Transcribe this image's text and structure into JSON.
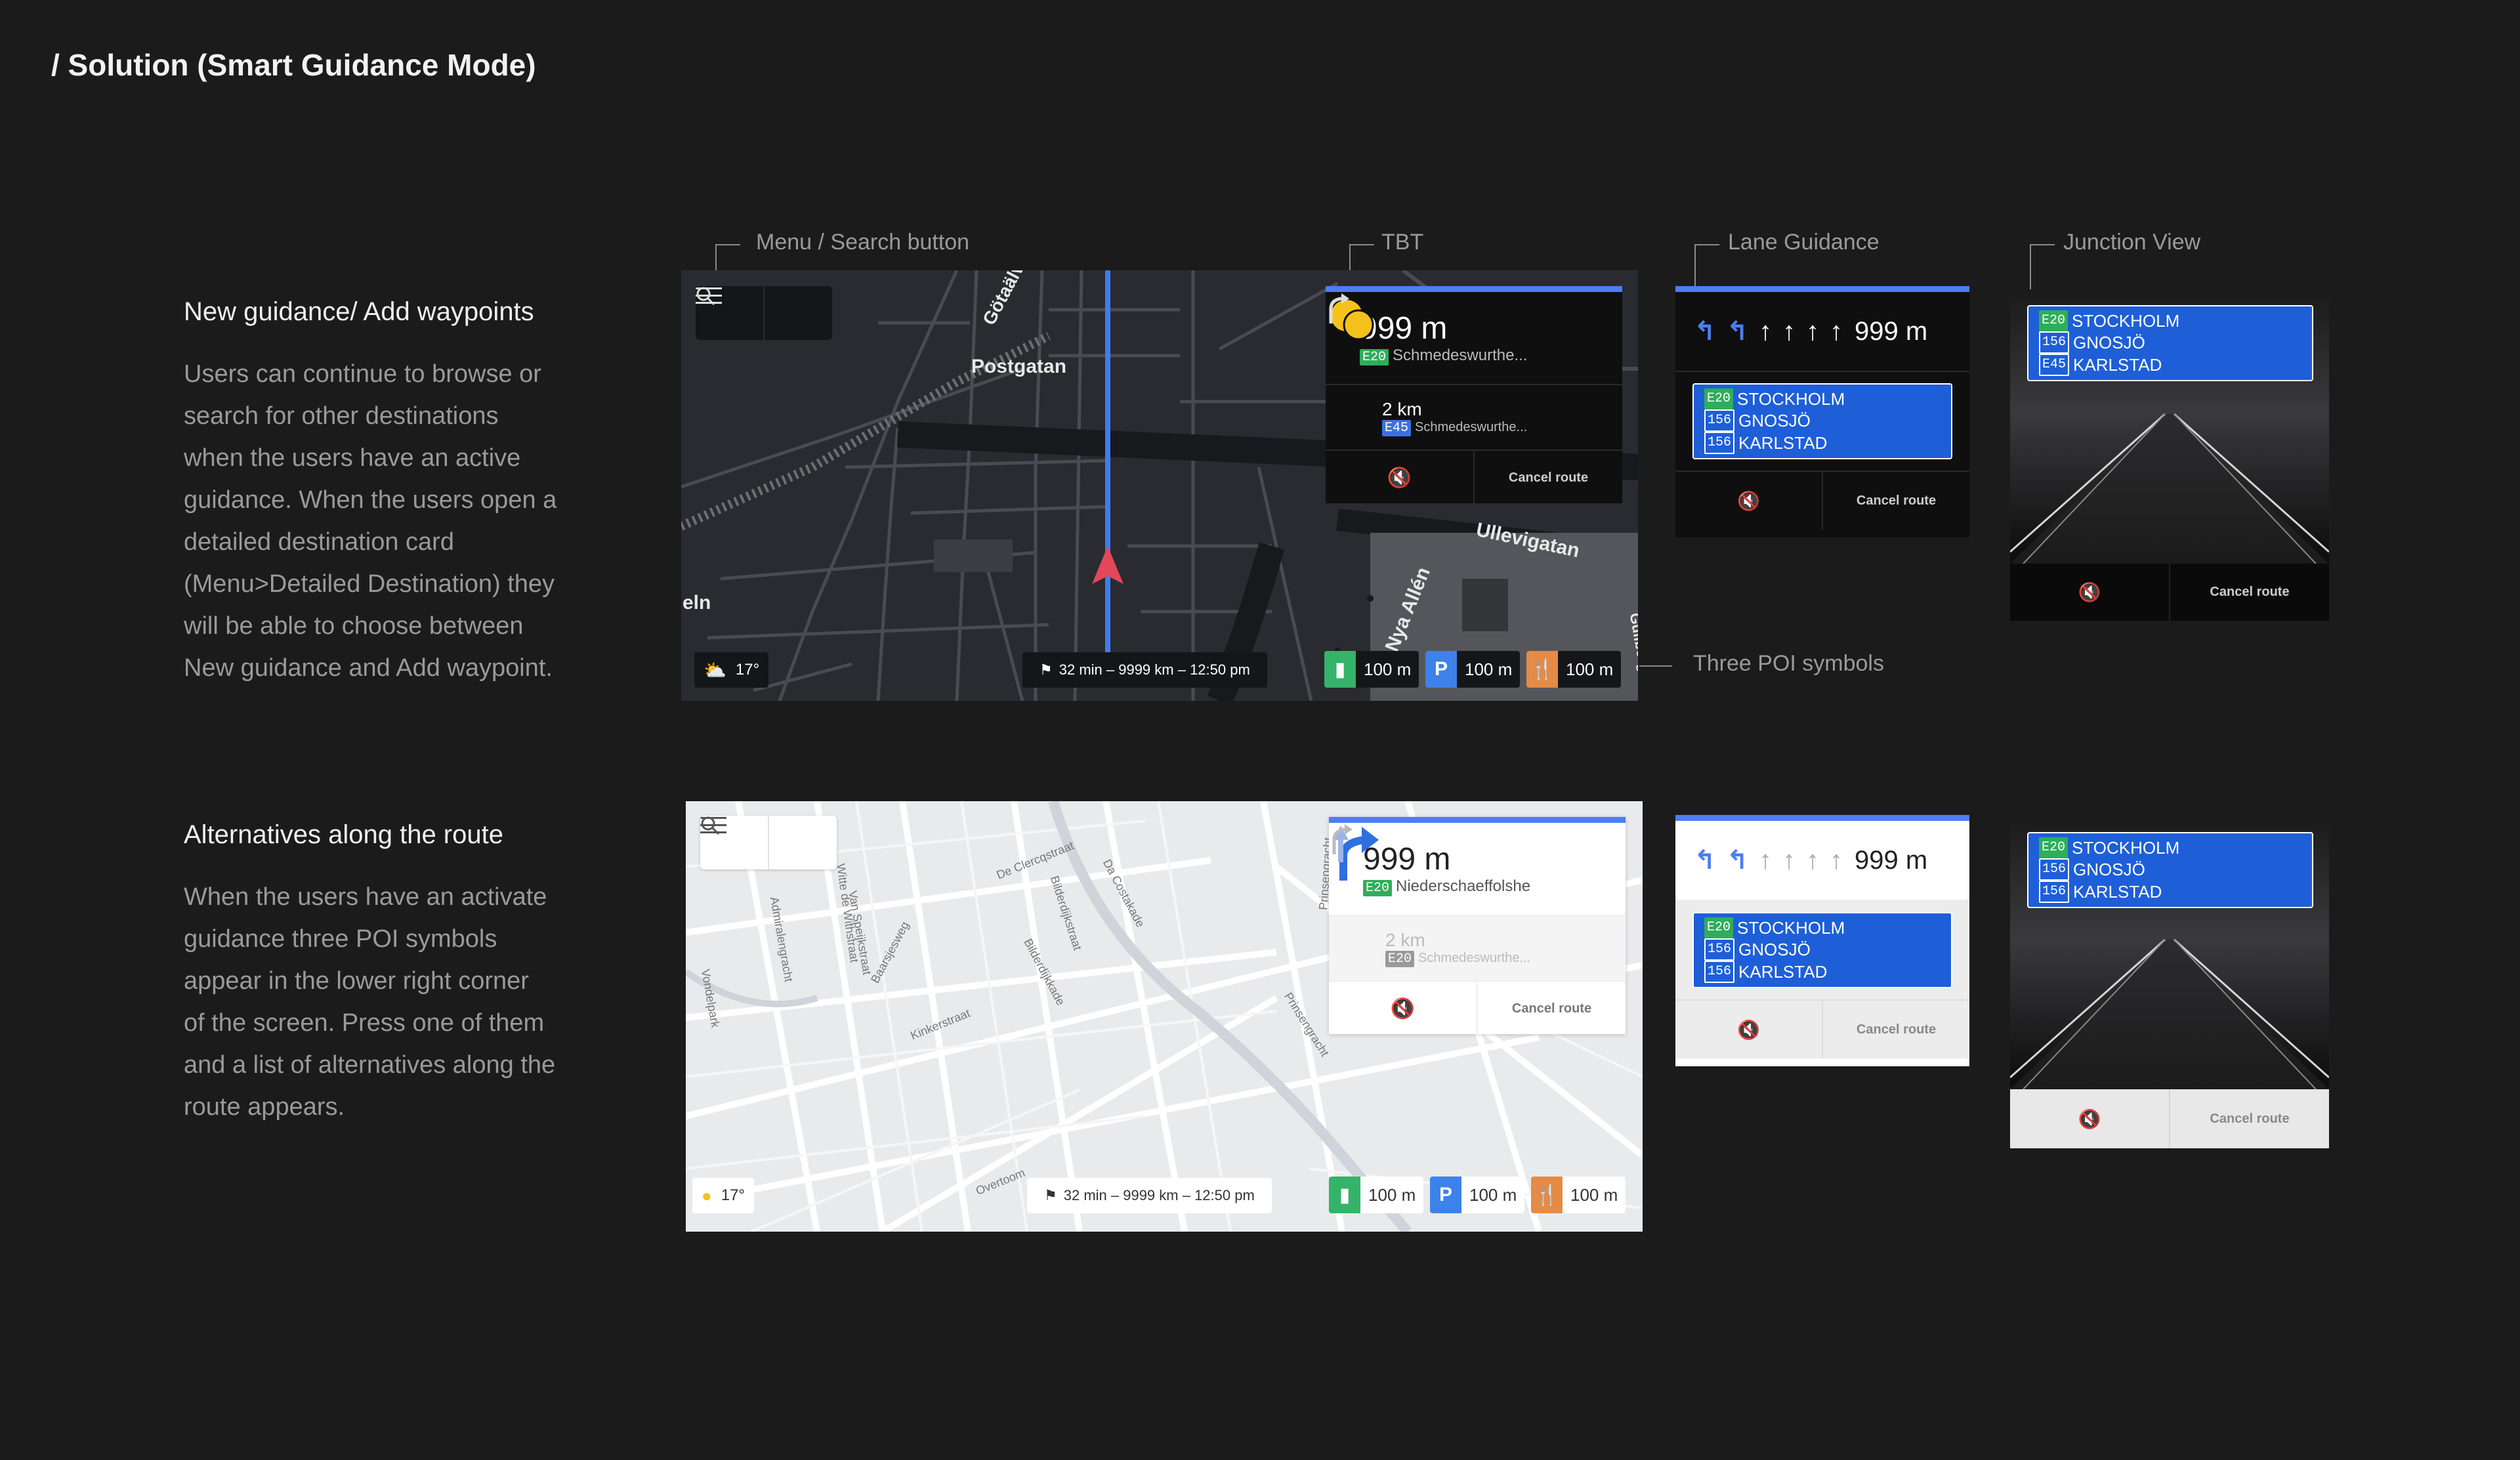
{
  "page_title": "/ Solution (Smart Guidance Mode)",
  "section1": {
    "heading": "New guidance/ Add waypoints",
    "body": [
      "Users can continue to browse or",
      "search for other destinations",
      "when the users have an active",
      "guidance. When the users open a",
      "detailed destination card",
      "(Menu>Detailed Destination) they",
      "will be able to choose between",
      "New guidance and Add waypoint."
    ]
  },
  "section2": {
    "heading": "Alternatives along the route",
    "body": [
      "When the users have an activate",
      "guidance three POI symbols",
      "appear in the lower right corner",
      "of the screen. Press one of them",
      "and a list of alternatives along the",
      "route appears."
    ]
  },
  "annotations": {
    "menu_search": "Menu / Search button",
    "tbt": "TBT",
    "lane_guidance": "Lane Guidance",
    "junction_view": "Junction View",
    "three_poi": "Three POI symbols"
  },
  "dark_map": {
    "street_labels": [
      "Postgatan",
      "Ullevigatan",
      "Nya Allén",
      "Götaälv",
      "eln",
      "Gullbergs"
    ],
    "tbt": {
      "distance": "999 m",
      "road_tag": "E20",
      "road_name": "Schmedeswurthe...",
      "next_distance": "2 km",
      "next_tag": "E45",
      "next_road": "Schmedeswurthe...",
      "cancel": "Cancel route"
    },
    "weather": "17°",
    "trip": "32 min – 9999 km – 12:50 pm",
    "poi": [
      {
        "icon": "fuel-icon",
        "distance": "100 m",
        "color": "#35b36a"
      },
      {
        "icon": "parking-icon",
        "label": "P",
        "distance": "100 m",
        "color": "#3d82ea"
      },
      {
        "icon": "restaurant-icon",
        "distance": "100 m",
        "color": "#e58b45"
      }
    ]
  },
  "light_map": {
    "street_labels": [
      "De Clercqstraat",
      "Da Costakade",
      "Bilderdijkstraat",
      "Bilderdijkkade",
      "Witte de Withstraat",
      "Van Speijkstraat",
      "Admiralengracht",
      "Baarsjesweg",
      "Kinkerstraat",
      "Overtoom",
      "Prinsengracht",
      "Prinsengracht",
      "Vondelpark"
    ],
    "tbt": {
      "distance": "999 m",
      "road_tag": "E20",
      "road_name": "Niederschaeffolshe",
      "next_distance": "2 km",
      "next_tag": "E20",
      "next_road": "Schmedeswurthe...",
      "cancel": "Cancel route"
    },
    "weather": "17°",
    "trip": "32 min – 9999 km – 12:50 pm",
    "poi": [
      {
        "icon": "fuel-icon",
        "distance": "100 m",
        "color": "#35b36a"
      },
      {
        "icon": "parking-icon",
        "label": "P",
        "distance": "100 m",
        "color": "#3d82ea"
      },
      {
        "icon": "restaurant-icon",
        "distance": "100 m",
        "color": "#e58b45"
      }
    ]
  },
  "lane_dark": {
    "distance": "999 m",
    "signs": [
      {
        "tag": "E20",
        "city": "STOCKHOLM"
      },
      {
        "tag": "156",
        "city": "GNOSJÖ"
      },
      {
        "tag": "156",
        "city": "KARLSTAD"
      }
    ],
    "cancel": "Cancel route"
  },
  "lane_light": {
    "distance": "999 m",
    "signs": [
      {
        "tag": "E20",
        "city": "STOCKHOLM"
      },
      {
        "tag": "156",
        "city": "GNOSJÖ"
      },
      {
        "tag": "156",
        "city": "KARLSTAD"
      }
    ],
    "cancel": "Cancel route"
  },
  "junction_dark": {
    "signs": [
      {
        "tag": "E20",
        "city": "STOCKHOLM"
      },
      {
        "tag": "156",
        "city": "GNOSJÖ"
      },
      {
        "tag": "E45",
        "city": "KARLSTAD"
      }
    ],
    "cancel": "Cancel route"
  },
  "junction_light": {
    "signs": [
      {
        "tag": "E20",
        "city": "STOCKHOLM"
      },
      {
        "tag": "156",
        "city": "GNOSJÖ"
      },
      {
        "tag": "156",
        "city": "KARLSTAD"
      }
    ],
    "cancel": "Cancel route"
  },
  "colors": {
    "background": "#1b1b1b",
    "accent_blue": "#4c7ef2",
    "sign_blue": "#1e5fd8",
    "route_arrow": "#e2475a"
  }
}
